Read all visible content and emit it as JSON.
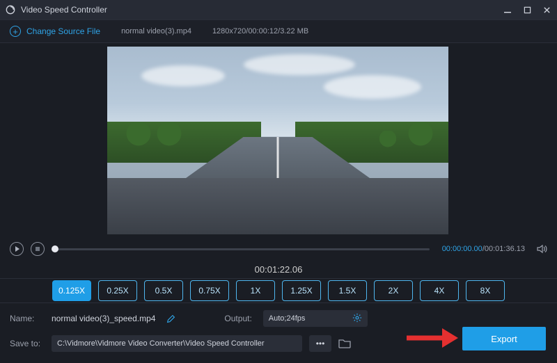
{
  "window": {
    "title": "Video Speed Controller"
  },
  "toolbar": {
    "change_source_label": "Change Source File",
    "file_name": "normal video(3).mp4",
    "file_meta": "1280x720/00:00:12/3.22 MB"
  },
  "transport": {
    "progress_position_pct": 1,
    "current_time_small": "00:00:00.00",
    "total_time": "00:01:36.13",
    "center_time": "00:01:22.06"
  },
  "speeds": {
    "options": [
      "0.125X",
      "0.25X",
      "0.5X",
      "0.75X",
      "1X",
      "1.25X",
      "1.5X",
      "2X",
      "4X",
      "8X"
    ],
    "selected_index": 0
  },
  "form": {
    "name_label": "Name:",
    "name_value": "normal video(3)_speed.mp4",
    "output_label": "Output:",
    "output_value": "Auto;24fps",
    "save_to_label": "Save to:",
    "save_to_value": "C:\\Vidmore\\Vidmore Video Converter\\Video Speed Controller"
  },
  "export": {
    "label": "Export"
  },
  "colors": {
    "accent": "#1f9ee7"
  }
}
